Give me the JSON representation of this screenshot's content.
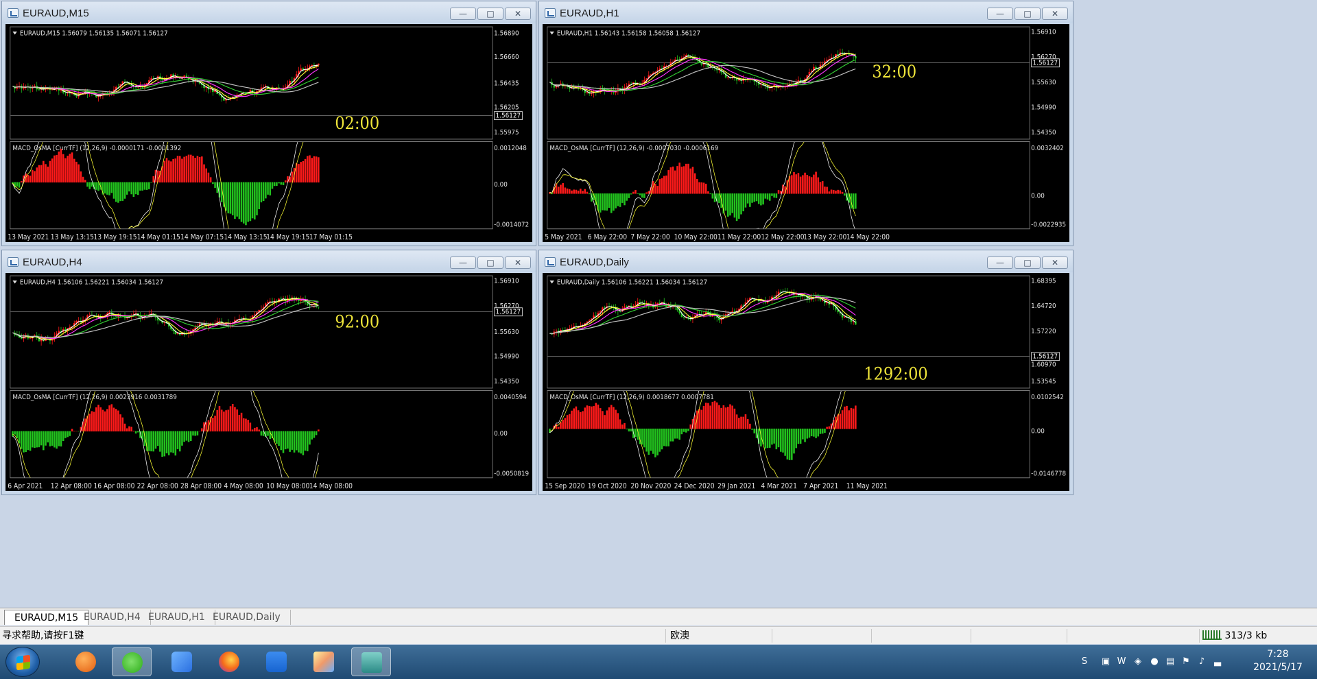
{
  "windows": [
    {
      "id": "m15",
      "title": "EURAUD,M15",
      "active": true,
      "header": "EURAUD,M15  1.56079 1.56135 1.56071 1.56127",
      "macd_header": "MACD_OsMA [CurrTF] (12,26,9) -0.0000171 -0.0001392",
      "price_labels": [
        "1.56890",
        "1.56660",
        "1.56435",
        "1.56205",
        "1.56127",
        "1.55975"
      ],
      "macd_labels": [
        "0.0012048",
        "0.00",
        "-0.0014072"
      ],
      "timer": "02:00",
      "xlabels": [
        "13 May 2021",
        "13 May 13:15",
        "13 May 19:15",
        "14 May 01:15",
        "14 May 07:15",
        "14 May 13:15",
        "14 May 19:15",
        "17 May 01:15"
      ]
    },
    {
      "id": "h1",
      "title": "EURAUD,H1",
      "active": false,
      "header": "EURAUD,H1  1.56143 1.56158 1.56058 1.56127",
      "macd_header": "MACD_OsMA [CurrTF] (12,26,9) -0.0007030 -0.0006169",
      "price_labels": [
        "1.56910",
        "1.56270",
        "1.56127",
        "1.55630",
        "1.54990",
        "1.54350"
      ],
      "macd_labels": [
        "0.0032402",
        "0.00",
        "-0.0022935"
      ],
      "timer": "32:00",
      "xlabels": [
        "5 May 2021",
        "6 May 22:00",
        "7 May 22:00",
        "10 May 22:00",
        "11 May 22:00",
        "12 May 22:00",
        "13 May 22:00",
        "14 May 22:00"
      ]
    },
    {
      "id": "h4",
      "title": "EURAUD,H4",
      "active": false,
      "header": "EURAUD,H4  1.56106 1.56221 1.56034 1.56127",
      "macd_header": "MACD_OsMA [CurrTF] (12,26,9) 0.0023916 0.0031789",
      "price_labels": [
        "1.56910",
        "1.56270",
        "1.56127",
        "1.55630",
        "1.54990",
        "1.54350"
      ],
      "macd_labels": [
        "0.0040594",
        "0.00",
        "-0.0050819"
      ],
      "timer": "92:00",
      "xlabels": [
        "6 Apr 2021",
        "12 Apr 08:00",
        "16 Apr 08:00",
        "22 Apr 08:00",
        "28 Apr 08:00",
        "4 May 08:00",
        "10 May 08:00",
        "14 May 08:00"
      ]
    },
    {
      "id": "d1",
      "title": "EURAUD,Daily",
      "active": false,
      "header": "EURAUD,Daily  1.56106 1.56221 1.56034 1.56127",
      "macd_header": "MACD_OsMA [CurrTF] (12,26,9) 0.0018677 0.0007781",
      "price_labels": [
        "1.68395",
        "1.64720",
        "1.60970",
        "1.57220",
        "1.56127",
        "1.53545"
      ],
      "macd_labels": [
        "0.0102542",
        "0.00",
        "-0.0146778"
      ],
      "timer": "1292:00",
      "xlabels": [
        "15 Sep 2020",
        "19 Oct 2020",
        "20 Nov 2020",
        "24 Dec 2020",
        "29 Jan 2021",
        "4 Mar 2021",
        "7 Apr 2021",
        "11 May 2021"
      ]
    }
  ],
  "tabs": [
    "EURAUD,M15",
    "EURAUD,H4",
    "EURAUD,H1",
    "EURAUD,Daily"
  ],
  "active_tab": 0,
  "status": {
    "help": "寻求帮助,请按F1键",
    "region": "欧澳",
    "traffic": "313/3 kb"
  },
  "clock": {
    "time": "7:28",
    "date": "2021/5/17"
  },
  "taskbar_apps": [
    "start-button",
    "orange-app-icon",
    "wechat-icon",
    "blue-pen-icon",
    "firefox-icon",
    "cloud-app-icon",
    "paint-app-icon",
    "metatrader-icon"
  ],
  "colors": {
    "bull": "#ff1a1a",
    "bear": "#22c21e",
    "ma_white": "#ffffff",
    "ma_yellow": "#ffff33",
    "ma_magenta": "#ff33ff",
    "ma_green": "#33cc33",
    "ma_gray": "#c0c0c0",
    "timer": "#f0e63a"
  }
}
